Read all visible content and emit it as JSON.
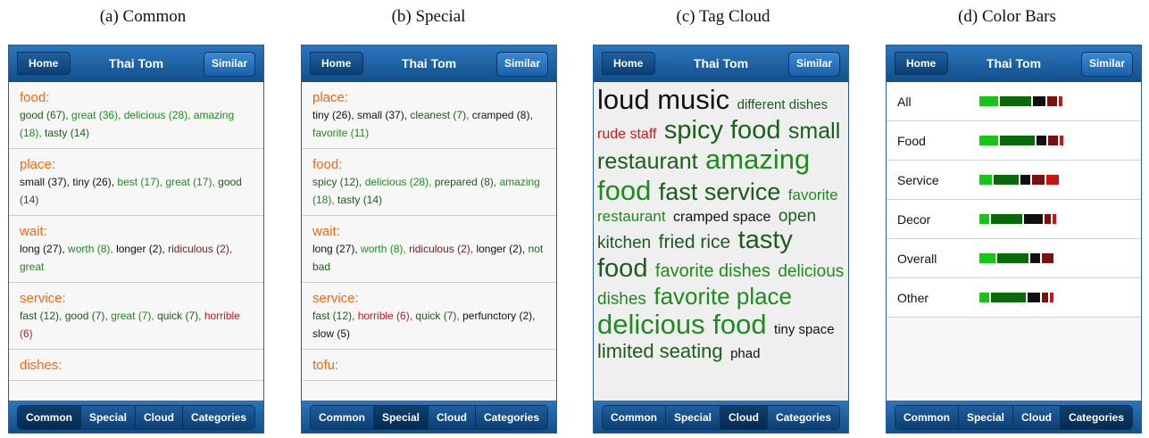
{
  "captions": [
    "(a) Common",
    "(b) Special",
    "(c) Tag Cloud",
    "(d) Color Bars"
  ],
  "nav": {
    "home": "Home",
    "title": "Thai Tom",
    "similar": "Similar"
  },
  "tabs": [
    "Common",
    "Special",
    "Cloud",
    "Categories"
  ],
  "colors": {
    "green": "#1d8c1d",
    "dark_green": "#1c5c1c",
    "black": "#111111",
    "maroon": "#7a1a1a",
    "red": "#c81818",
    "heading": "#f06a0f"
  },
  "common": [
    {
      "title": "food:",
      "terms": [
        {
          "text": "good (67),",
          "c": "dark"
        },
        {
          "text": "great (36),",
          "c": "green"
        },
        {
          "text": "delicious (28),",
          "c": "green"
        },
        {
          "text": "amazing (18),",
          "c": "green"
        },
        {
          "text": "tasty (14)",
          "c": "dark"
        }
      ]
    },
    {
      "title": "place:",
      "terms": [
        {
          "text": "small (37),",
          "c": "black"
        },
        {
          "text": "tiny (26),",
          "c": "black"
        },
        {
          "text": "best (17),",
          "c": "green"
        },
        {
          "text": "great (17),",
          "c": "green"
        },
        {
          "text": "good (14)",
          "c": "dark"
        }
      ]
    },
    {
      "title": "wait:",
      "terms": [
        {
          "text": "long (27),",
          "c": "black"
        },
        {
          "text": "worth (8),",
          "c": "green"
        },
        {
          "text": "longer (2),",
          "c": "black"
        },
        {
          "text": "ridiculous (2),",
          "c": "maroon"
        },
        {
          "text": "great",
          "c": "green"
        }
      ]
    },
    {
      "title": "service:",
      "terms": [
        {
          "text": "fast (12),",
          "c": "dark"
        },
        {
          "text": "good (7),",
          "c": "dark"
        },
        {
          "text": "great (7),",
          "c": "green"
        },
        {
          "text": "quick (7),",
          "c": "dark"
        },
        {
          "text": "horrible (6)",
          "c": "red"
        }
      ]
    },
    {
      "title": "dishes:",
      "terms": []
    }
  ],
  "special": [
    {
      "title": "place:",
      "terms": [
        {
          "text": "tiny (26),",
          "c": "black"
        },
        {
          "text": "small (37),",
          "c": "black"
        },
        {
          "text": "cleanest (7),",
          "c": "dark"
        },
        {
          "text": "cramped (8),",
          "c": "black"
        },
        {
          "text": "favorite (11)",
          "c": "green"
        }
      ]
    },
    {
      "title": "food:",
      "terms": [
        {
          "text": "spicy (12),",
          "c": "dark"
        },
        {
          "text": "delicious (28),",
          "c": "green"
        },
        {
          "text": "prepared (8),",
          "c": "dark"
        },
        {
          "text": "amazing (18),",
          "c": "green"
        },
        {
          "text": "tasty (14)",
          "c": "dark"
        }
      ]
    },
    {
      "title": "wait:",
      "terms": [
        {
          "text": "long (27),",
          "c": "black"
        },
        {
          "text": "worth (8),",
          "c": "green"
        },
        {
          "text": "ridiculous (2),",
          "c": "maroon"
        },
        {
          "text": "longer (2),",
          "c": "black"
        },
        {
          "text": "not bad",
          "c": "dark"
        }
      ]
    },
    {
      "title": "service:",
      "terms": [
        {
          "text": "fast (12),",
          "c": "dark"
        },
        {
          "text": "horrible (6),",
          "c": "red"
        },
        {
          "text": "quick (7),",
          "c": "dark"
        },
        {
          "text": "perfunctory (2),",
          "c": "black"
        },
        {
          "text": "slow (5)",
          "c": "black"
        }
      ]
    },
    {
      "title": "tofu:",
      "terms": []
    }
  ],
  "cloud": [
    {
      "text": "loud music",
      "size": 31,
      "c": "black"
    },
    {
      "text": "different dishes",
      "size": 15,
      "c": "dark"
    },
    {
      "text": "rude staff",
      "size": 16,
      "c": "red"
    },
    {
      "text": "spicy food",
      "size": 29,
      "c": "dark"
    },
    {
      "text": "small restaurant",
      "size": 25,
      "c": "dark"
    },
    {
      "text": "amazing food",
      "size": 31,
      "c": "green"
    },
    {
      "text": "fast service",
      "size": 27,
      "c": "dark"
    },
    {
      "text": "favorite restaurant",
      "size": 17,
      "c": "green"
    },
    {
      "text": "cramped space",
      "size": 16,
      "c": "black"
    },
    {
      "text": "open kitchen",
      "size": 19,
      "c": "dark"
    },
    {
      "text": "fried rice",
      "size": 21,
      "c": "dark"
    },
    {
      "text": "tasty food",
      "size": 29,
      "c": "dark"
    },
    {
      "text": "favorite dishes",
      "size": 20,
      "c": "green"
    },
    {
      "text": "delicious dishes",
      "size": 19,
      "c": "green"
    },
    {
      "text": "favorite place",
      "size": 26,
      "c": "green"
    },
    {
      "text": "delicious food",
      "size": 31,
      "c": "green"
    },
    {
      "text": "tiny space",
      "size": 15,
      "c": "black"
    },
    {
      "text": "limited seating",
      "size": 22,
      "c": "dark"
    },
    {
      "text": "phad",
      "size": 15,
      "c": "black"
    }
  ],
  "categories": [
    {
      "label": "All",
      "segments": [
        {
          "v": 3,
          "col": "#18c418"
        },
        {
          "v": 5,
          "col": "#0a6a0a"
        },
        {
          "v": 2,
          "col": "#111111"
        },
        {
          "v": 1.5,
          "col": "#7a1010"
        },
        {
          "v": 0.6,
          "col": "#cc1414"
        }
      ]
    },
    {
      "label": "Food",
      "segments": [
        {
          "v": 3,
          "col": "#18c418"
        },
        {
          "v": 5.5,
          "col": "#0a6a0a"
        },
        {
          "v": 1.5,
          "col": "#111111"
        },
        {
          "v": 1.5,
          "col": "#7a1010"
        },
        {
          "v": 0.5,
          "col": "#cc1414"
        }
      ]
    },
    {
      "label": "Service",
      "segments": [
        {
          "v": 2,
          "col": "#18c418"
        },
        {
          "v": 4,
          "col": "#0a6a0a"
        },
        {
          "v": 1.5,
          "col": "#111111"
        },
        {
          "v": 2,
          "col": "#7a1010"
        },
        {
          "v": 2,
          "col": "#cc1414"
        }
      ]
    },
    {
      "label": "Decor",
      "segments": [
        {
          "v": 1.5,
          "col": "#18c418"
        },
        {
          "v": 5,
          "col": "#0a6a0a"
        },
        {
          "v": 3,
          "col": "#111111"
        },
        {
          "v": 1,
          "col": "#7a1010"
        },
        {
          "v": 0.5,
          "col": "#cc1414"
        }
      ]
    },
    {
      "label": "Overall",
      "segments": [
        {
          "v": 2.5,
          "col": "#18c418"
        },
        {
          "v": 5,
          "col": "#0a6a0a"
        },
        {
          "v": 1.5,
          "col": "#111111"
        },
        {
          "v": 1.8,
          "col": "#7a1010"
        }
      ]
    },
    {
      "label": "Other",
      "segments": [
        {
          "v": 1.5,
          "col": "#18c418"
        },
        {
          "v": 5.5,
          "col": "#0a6a0a"
        },
        {
          "v": 2,
          "col": "#111111"
        },
        {
          "v": 1,
          "col": "#7a1010"
        },
        {
          "v": 0.5,
          "col": "#cc1414"
        }
      ]
    }
  ]
}
